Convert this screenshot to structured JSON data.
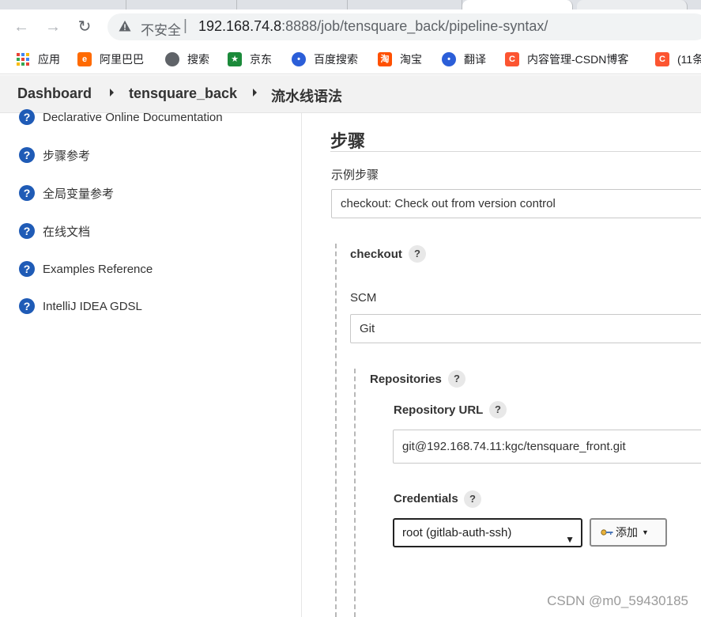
{
  "browser": {
    "insecure_label": "不安全",
    "url_host": "192.168.74.8",
    "url_rest": ":8888/job/tensquare_back/pipeline-syntax/"
  },
  "bookmarks": [
    {
      "label": "应用",
      "icon": "apps-grid-icon"
    },
    {
      "label": "阿里巴巴",
      "icon": "alibaba-icon"
    },
    {
      "label": "搜索",
      "icon": "globe-icon"
    },
    {
      "label": "京东",
      "icon": "jd-icon"
    },
    {
      "label": "百度搜索",
      "icon": "baidu-paw-icon"
    },
    {
      "label": "淘宝",
      "icon": "taobao-icon"
    },
    {
      "label": "翻译",
      "icon": "baidu-paw-icon"
    },
    {
      "label": "内容管理-CSDN博客",
      "icon": "csdn-icon"
    },
    {
      "label": "(11条",
      "icon": "csdn-icon"
    }
  ],
  "breadcrumb": [
    "Dashboard",
    "tensquare_back",
    "流水线语法"
  ],
  "sidebar": {
    "items": [
      {
        "label": "Declarative Online Documentation"
      },
      {
        "label": "步骤参考"
      },
      {
        "label": "全局变量参考"
      },
      {
        "label": "在线文档"
      },
      {
        "label": "Examples Reference"
      },
      {
        "label": "IntelliJ IDEA GDSL"
      }
    ]
  },
  "main": {
    "section_title": "步骤",
    "sample_step_label": "示例步骤",
    "sample_step_value": "checkout: Check out from version control",
    "checkout_label": "checkout",
    "scm_label": "SCM",
    "scm_value": "Git",
    "repositories_label": "Repositories",
    "repo_url_label": "Repository URL",
    "repo_url_value": "git@192.168.74.11:kgc/tensquare_front.git",
    "credentials_label": "Credentials",
    "credentials_value": "root (gitlab-auth-ssh)",
    "add_button_label": "添加",
    "help_glyph": "?"
  },
  "watermark": "CSDN @m0_59430185",
  "colors": {
    "help_icon_blue": "#1f5bb6",
    "breadcrumb_bg": "#f2f2f2"
  }
}
